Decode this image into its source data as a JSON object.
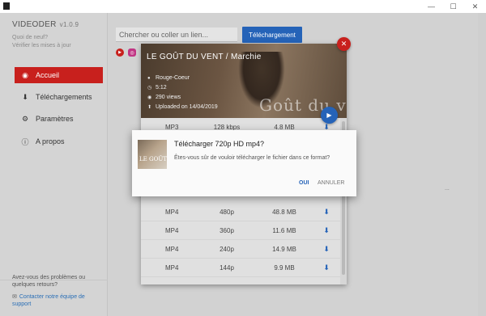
{
  "window": {
    "minimize": "—",
    "maximize": "☐",
    "close": "✕"
  },
  "sidebar": {
    "app_name": "VIDEODER",
    "version": "v1.0.9",
    "news_line1": "Quoi de neuf?",
    "news_line2": "Vérifier les mises à jour",
    "items": [
      {
        "label": "Accueil",
        "icon": "compass-icon",
        "glyph": "◉",
        "active": true
      },
      {
        "label": "Téléchargements",
        "icon": "download-icon",
        "glyph": "⬇",
        "active": false
      },
      {
        "label": "Paramètres",
        "icon": "gear-icon",
        "glyph": "⚙",
        "active": false
      },
      {
        "label": "A propos",
        "icon": "info-icon",
        "glyph": "ⓘ",
        "active": false
      }
    ],
    "help_text": "Avez-vous des problèmes ou quelques retours?",
    "contact_link": "Contacter notre équipe de support"
  },
  "main": {
    "search_placeholder": "Chercher ou coller un lien...",
    "download_button": "Téléchargement",
    "sites": [
      "youtube-icon",
      "instagram-icon"
    ],
    "behind_text": "..."
  },
  "video": {
    "title": "LE GOÛT DU VENT / Marchie",
    "channel": "Rouge-Coeur",
    "duration": "5:12",
    "views": "290 views",
    "uploaded": "Uploaded on 14/04/2019",
    "wordmark": "Goût du vent"
  },
  "formats": [
    {
      "format": "MP3",
      "quality": "128 kbps",
      "size": "4.8 MB"
    },
    {
      "format": "MP4",
      "quality": "480p",
      "size": "48.8 MB"
    },
    {
      "format": "MP4",
      "quality": "360p",
      "size": "11.6 MB"
    },
    {
      "format": "MP4",
      "quality": "240p",
      "size": "14.9 MB"
    },
    {
      "format": "MP4",
      "quality": "144p",
      "size": "9.9 MB"
    }
  ],
  "dialog": {
    "title": "Télécharger 720p HD mp4?",
    "body": "Êtes-vous sûr de vouloir télécharger le fichier dans ce format?",
    "confirm": "OUI",
    "cancel": "ANNULER",
    "thumb_text": "LE GOÛT D"
  },
  "colors": {
    "accent_red": "#c8201d",
    "accent_blue": "#2563b8"
  }
}
